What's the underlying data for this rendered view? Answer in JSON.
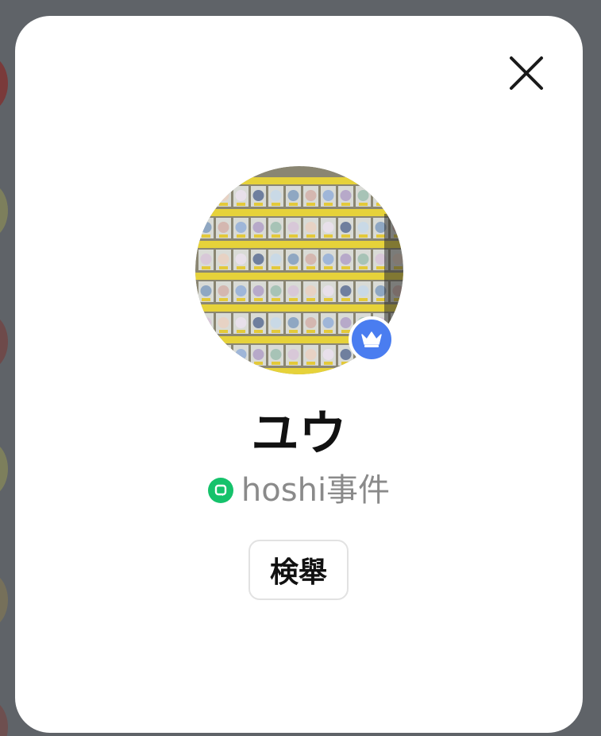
{
  "profile": {
    "name": "ユウ",
    "group_name": "hoshi事件",
    "avatar_icon": "collectible-badges-photo",
    "badge_icon": "crown-icon",
    "badge_color": "#4a7df0",
    "group_icon": "chat-bubble-icon",
    "group_icon_color": "#15c26b"
  },
  "actions": {
    "report_label": "検舉",
    "close_icon": "close-icon"
  },
  "colors": {
    "backdrop": "#5f6368",
    "modal": "#ffffff"
  }
}
